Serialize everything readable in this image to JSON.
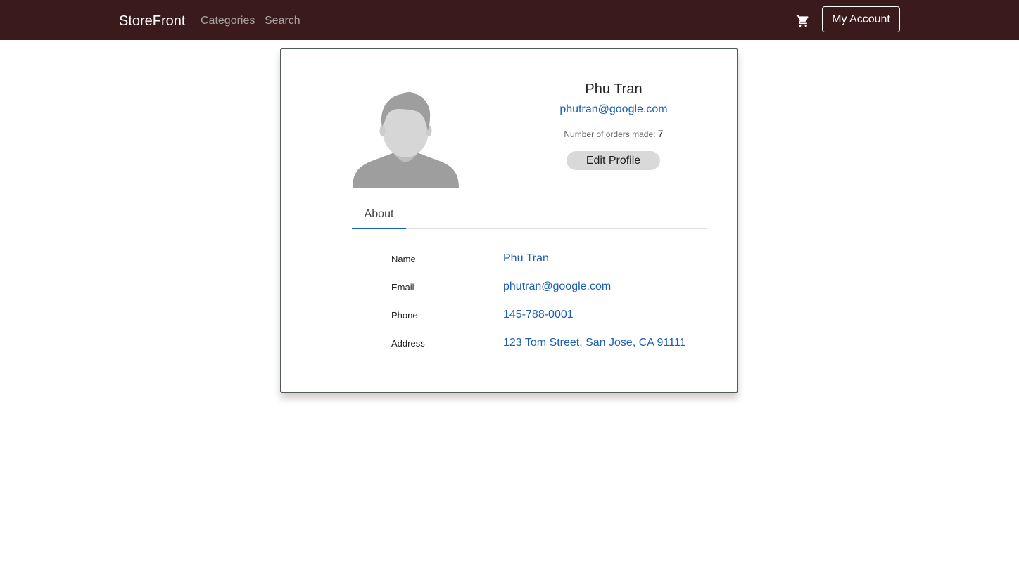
{
  "navbar": {
    "brand": "StoreFront",
    "links": [
      "Categories",
      "Search"
    ],
    "cart_icon": "shopping-cart-icon",
    "account_label": "My Account"
  },
  "profile": {
    "name": "Phu Tran",
    "email": "phutran@google.com",
    "orders_label": "Number of orders made:",
    "orders_count": "7",
    "edit_label": "Edit Profile",
    "avatar_icon": "default-user-avatar"
  },
  "tabs": {
    "about": "About"
  },
  "about": {
    "rows": [
      {
        "label": "Name",
        "value": "Phu Tran"
      },
      {
        "label": "Email",
        "value": "phutran@google.com"
      },
      {
        "label": "Phone",
        "value": "145-788-0001"
      },
      {
        "label": "Address",
        "value": "123 Tom Street, San Jose, CA 91111"
      }
    ]
  },
  "colors": {
    "navbar_bg": "#3b1a1b",
    "link_blue": "#1a5fb4",
    "button_gray": "#d9d9d9"
  }
}
